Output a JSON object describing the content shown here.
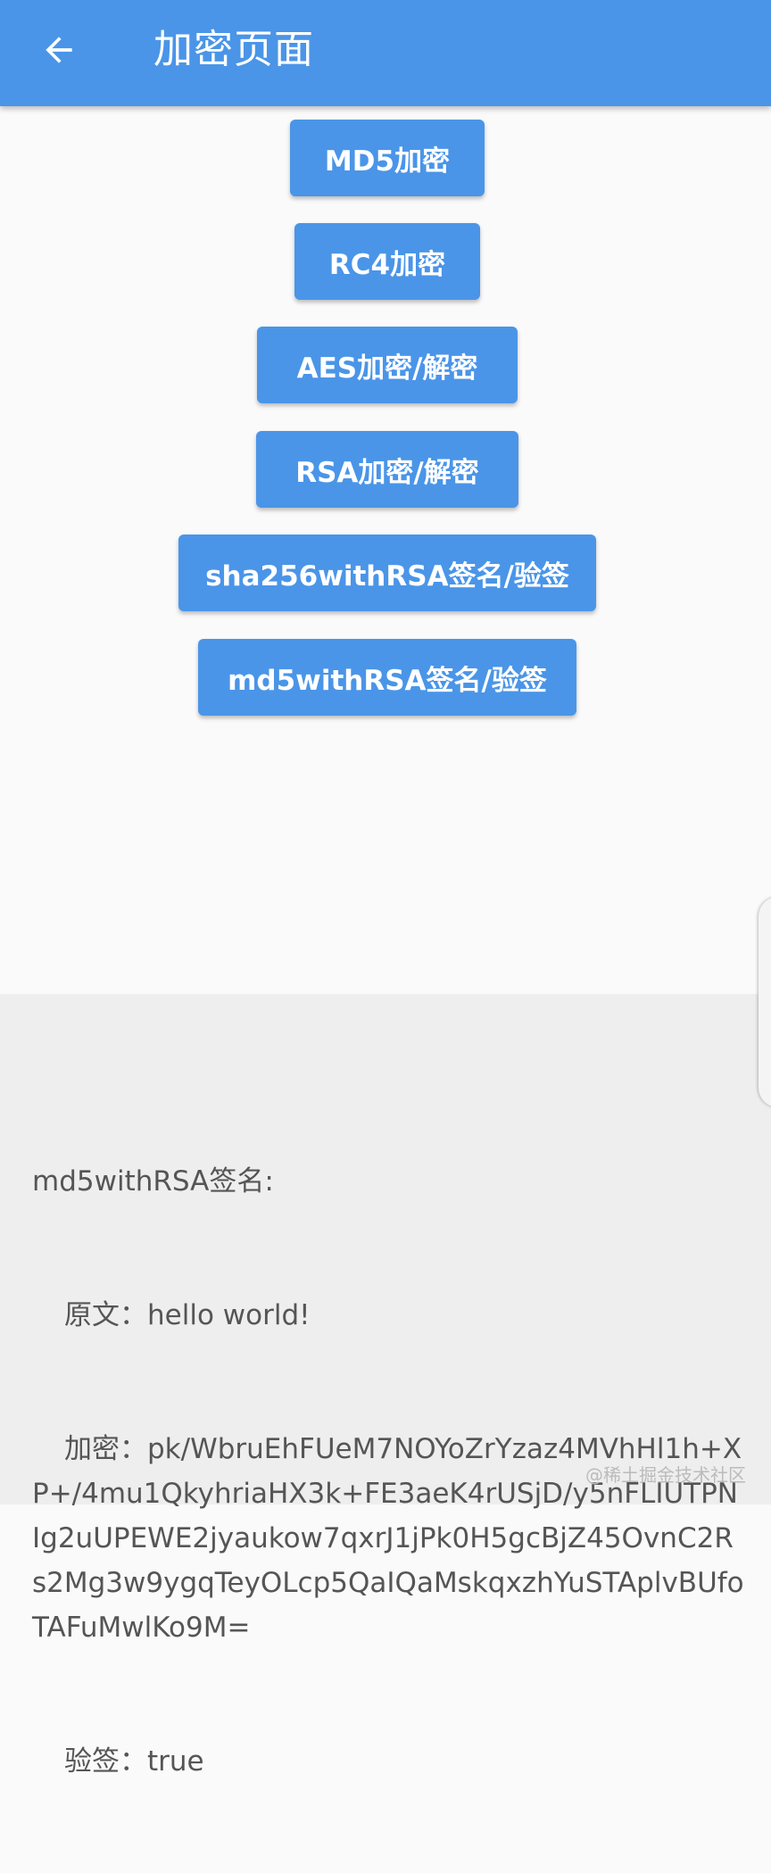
{
  "appbar": {
    "title": "加密页面",
    "back_icon": "arrow-left-icon",
    "color": "#4a95e8"
  },
  "buttons": [
    {
      "label": "MD5加密"
    },
    {
      "label": "RC4加密"
    },
    {
      "label": "AES加密/解密"
    },
    {
      "label": "RSA加密/解密"
    },
    {
      "label": "sha256withRSA签名/验签"
    },
    {
      "label": "md5withRSA签名/验签"
    }
  ],
  "result": {
    "header": "md5withRSA签名:",
    "plaintext_label": "原文：",
    "plaintext_value": "hello world!",
    "encrypt_label": "加密：",
    "encrypt_value": "pk/WbruEhFUeM7NOYoZrYzaz4MVhHl1h+XP+/4mu1QkyhriaHX3k+FE3aeK4rUSjD/y5nFLIUTPNIg2uUPEWE2jyaukow7qxrJ1jPk0H5gcBjZ45OvnC2Rs2Mg3w9ygqTeyOLcp5QaIQaMskqxzhYuSTAplvBUfoTAFuMwlKo9M=",
    "verify_label": "验签：",
    "verify_value": "true"
  },
  "watermark": "@稀土掘金技术社区"
}
